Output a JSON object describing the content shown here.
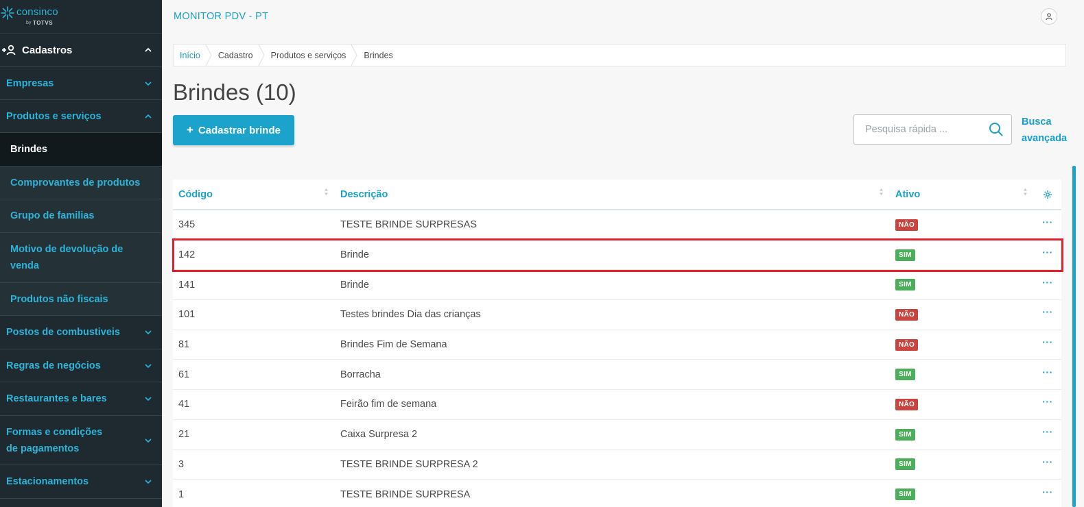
{
  "brand": {
    "name": "consinco",
    "by": "by",
    "partner": "TOTVS"
  },
  "sidebar": {
    "header": {
      "label": "Cadastros"
    },
    "items": [
      {
        "label": "Empresas"
      },
      {
        "label": "Produtos e serviços"
      },
      {
        "label": "Postos de combustiveis"
      },
      {
        "label": "Regras de negócios"
      },
      {
        "label": "Restaurantes e bares"
      },
      {
        "label": "Formas e condições de pagamentos"
      },
      {
        "label": "Estacionamentos"
      }
    ],
    "subitems": [
      {
        "label": "Brindes"
      },
      {
        "label": "Comprovantes de produtos"
      },
      {
        "label": "Grupo de familias"
      },
      {
        "label": "Motivo de devolução de venda"
      },
      {
        "label": "Produtos não fiscais"
      }
    ]
  },
  "topbar": {
    "title": "MONITOR PDV - PT"
  },
  "breadcrumb": [
    "Início",
    "Cadastro",
    "Produtos e serviços",
    "Brindes"
  ],
  "page": {
    "title": "Brindes (10)"
  },
  "actions": {
    "add_label": "Cadastrar brinde",
    "add_icon": "+",
    "search_placeholder": "Pesquisa rápida ...",
    "advanced_search": "Busca avançada"
  },
  "table": {
    "columns": [
      "Código",
      "Descrição",
      "Ativo"
    ],
    "row_action": "···",
    "rows": [
      {
        "codigo": "345",
        "descricao": "TESTE BRINDE SURPRESAS",
        "ativo": "NÃO"
      },
      {
        "codigo": "142",
        "descricao": "Brinde",
        "ativo": "SIM"
      },
      {
        "codigo": "141",
        "descricao": "Brinde",
        "ativo": "SIM"
      },
      {
        "codigo": "101",
        "descricao": "Testes brindes Dia das crianças",
        "ativo": "NÃO"
      },
      {
        "codigo": "81",
        "descricao": "Brindes Fim de Semana",
        "ativo": "NÃO"
      },
      {
        "codigo": "61",
        "descricao": "Borracha",
        "ativo": "SIM"
      },
      {
        "codigo": "41",
        "descricao": "Feirão fim de semana",
        "ativo": "NÃO"
      },
      {
        "codigo": "21",
        "descricao": "Caixa Surpresa 2",
        "ativo": "SIM"
      },
      {
        "codigo": "3",
        "descricao": "TESTE BRINDE SURPRESA 2",
        "ativo": "SIM"
      },
      {
        "codigo": "1",
        "descricao": "TESTE BRINDE SURPRESA",
        "ativo": "SIM"
      }
    ]
  },
  "colors": {
    "accent": "#1ba3cb",
    "sidebar": "#1e2a2f",
    "no": "#c9433f",
    "yes": "#4cae5a",
    "highlight": "#e0202e"
  }
}
